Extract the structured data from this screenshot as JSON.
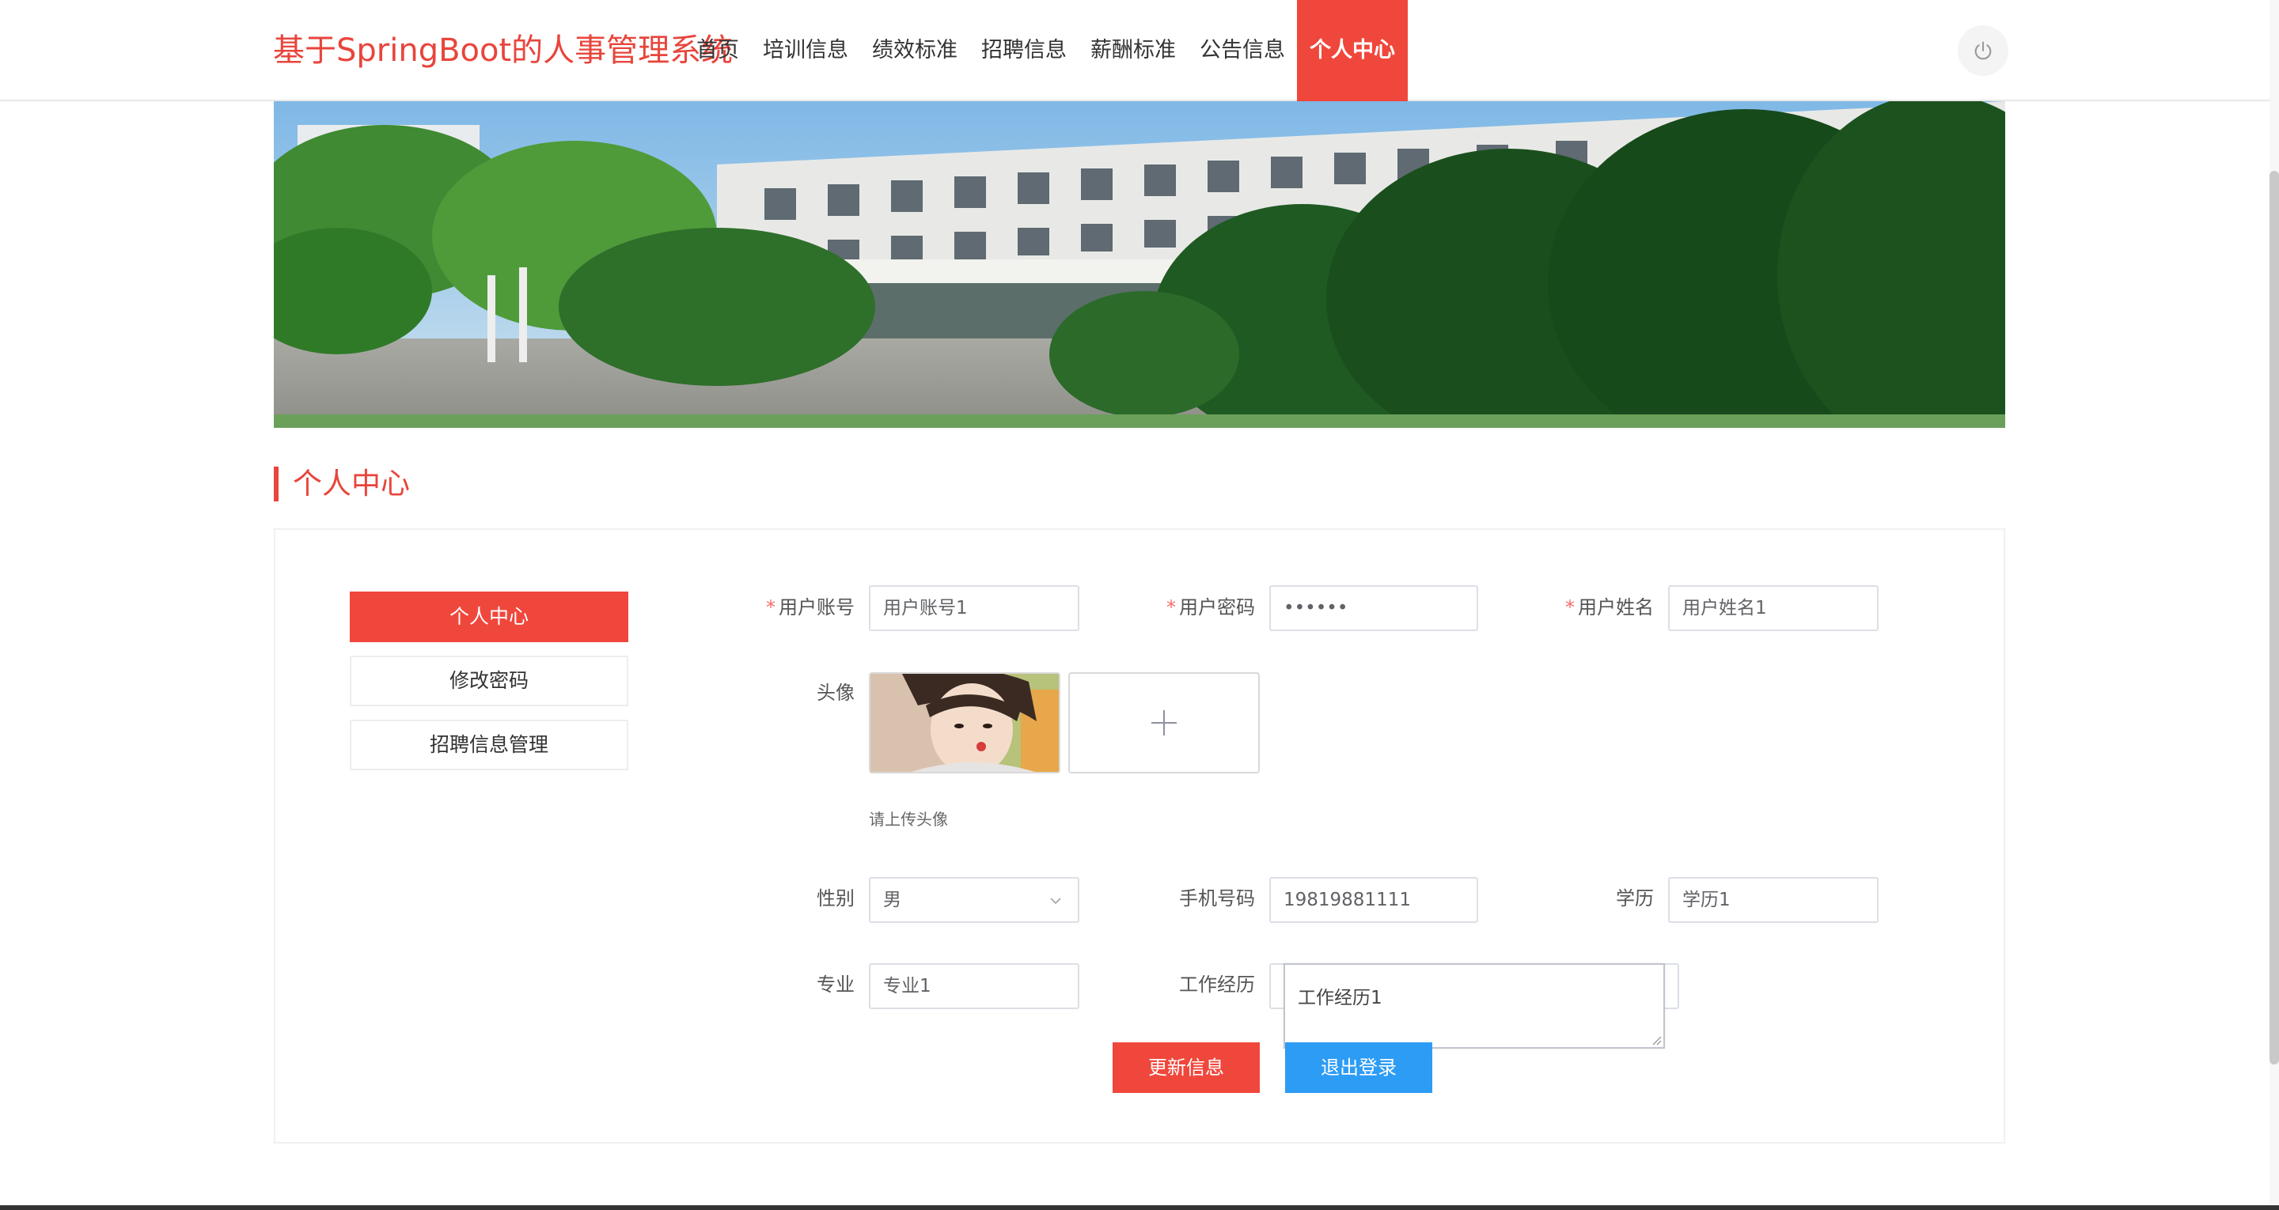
{
  "header": {
    "brand": "基于SpringBoot的人事管理系统",
    "nav": [
      {
        "label": "首页"
      },
      {
        "label": "培训信息"
      },
      {
        "label": "绩效标准"
      },
      {
        "label": "招聘信息"
      },
      {
        "label": "薪酬标准"
      },
      {
        "label": "公告信息"
      },
      {
        "label": "个人中心"
      }
    ],
    "active_nav": "个人中心",
    "power_icon": "power-icon"
  },
  "section": {
    "title": "个人中心"
  },
  "sidebar": {
    "items": [
      {
        "label": "个人中心"
      },
      {
        "label": "修改密码"
      },
      {
        "label": "招聘信息管理"
      }
    ],
    "active": "个人中心"
  },
  "form": {
    "account": {
      "label": "用户账号",
      "value": "用户账号1",
      "required": "*"
    },
    "password": {
      "label": "用户密码",
      "value": "••••••",
      "required": "*"
    },
    "name": {
      "label": "用户姓名",
      "value": "用户姓名1",
      "required": "*"
    },
    "avatar": {
      "label": "头像",
      "hint": "请上传头像",
      "upload_icon": "plus-icon"
    },
    "gender": {
      "label": "性别",
      "value": "男"
    },
    "phone": {
      "label": "手机号码",
      "value": "19819881111"
    },
    "education": {
      "label": "学历",
      "value": "学历1"
    },
    "major": {
      "label": "专业",
      "value": "专业1"
    },
    "experience": {
      "label": "工作经历",
      "value": "工作经历1"
    }
  },
  "actions": {
    "update": "更新信息",
    "logout": "退出登录"
  },
  "colors": {
    "accent": "#f0473c",
    "brand_text": "#e8453c",
    "blue_button": "#2d9cf5"
  }
}
